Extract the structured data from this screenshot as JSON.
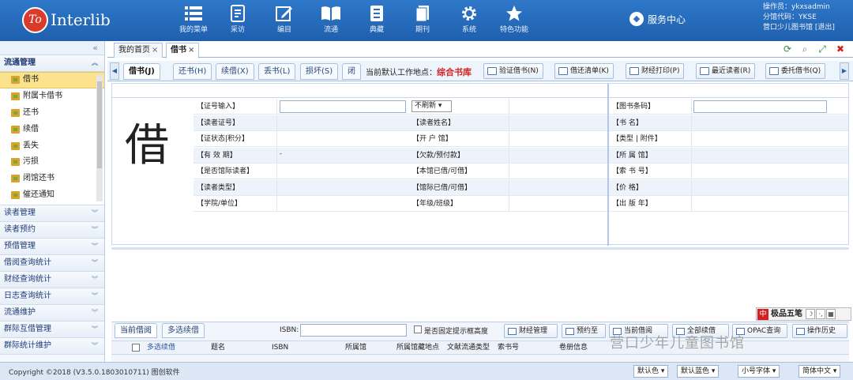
{
  "header": {
    "logo_text": "To",
    "brand": "Interlib",
    "nav": [
      {
        "label": "我的菜单",
        "icon": "menu-list-icon"
      },
      {
        "label": "采访",
        "icon": "document-icon"
      },
      {
        "label": "编目",
        "icon": "edit-icon"
      },
      {
        "label": "流通",
        "icon": "open-book-icon"
      },
      {
        "label": "典藏",
        "icon": "archive-icon"
      },
      {
        "label": "期刊",
        "icon": "periodical-icon"
      },
      {
        "label": "系统",
        "icon": "gear-icon"
      },
      {
        "label": "特色功能",
        "icon": "star-icon"
      }
    ],
    "service_center": "服务中心",
    "operator": "操作员：ykxsadmin",
    "branch_code": "分馆代码：YKSE",
    "library": "营口少儿图书馆",
    "logout": "[退出]"
  },
  "sidebar": {
    "collapse_icon": "«",
    "open_section": "流通管理",
    "items": [
      "借书",
      "附属卡借书",
      "还书",
      "续借",
      "丢失",
      "污损",
      "闭馆还书",
      "催还通知"
    ],
    "active_item": "借书",
    "sections": [
      "读者管理",
      "读者预约",
      "预借管理",
      "借阅查询统计",
      "财经查询统计",
      "日志查询统计",
      "流通维护",
      "群际互借管理",
      "群际统计维护"
    ]
  },
  "page_tabs": [
    {
      "label": "我的首页",
      "close": "×"
    },
    {
      "label": "借书",
      "close": "×"
    }
  ],
  "sub_tabs": [
    "借书(J)",
    "还书(H)",
    "续借(X)",
    "丢书(L)",
    "损坏(S)",
    "闭"
  ],
  "work_location": {
    "label": "当前默认工作地点：",
    "value": "综合书库"
  },
  "toolbar_buttons": [
    "验证借书(N)",
    "借还清单(K)",
    "财经打印(P)",
    "最近读者(R)",
    "委托借书(Q)"
  ],
  "form": {
    "big_char": "借",
    "left_labels": [
      "【证号输入】",
      "【读者证号】",
      "【证状态|积分】",
      "【有 效 期】",
      "【是否馆际读者】",
      "【读者类型】",
      "【学院/单位】"
    ],
    "mid_labels": [
      "【读者姓名】",
      "【开 户 馆】",
      "【欠款/预付款】",
      "【本馆已借/可借】",
      "【馆际已借/可借】",
      "【年级/班级】"
    ],
    "right_labels": [
      "【图书条码】",
      "【书 名】",
      "【类型 | 附件】",
      "【所 属 馆】",
      "【索 书 号】",
      "【价 格】",
      "【出 版 年】"
    ],
    "refresh_select": "不刷新 ▾",
    "validity_mark": "-"
  },
  "lower": {
    "tabs": [
      "当前借阅",
      "多选续借"
    ],
    "isbn_label": "ISBN:",
    "fixed_height_label": "是否固定提示框高度",
    "buttons": [
      "财经管理",
      "预约至",
      "当前借阅",
      "全部续借",
      "OPAC查询",
      "操作历史"
    ],
    "columns": [
      "多选续借",
      "题名",
      "ISBN",
      "所属馆",
      "所属馆藏地点",
      "文献流通类型",
      "索书号",
      "卷册信息"
    ]
  },
  "ime": {
    "zh": "中",
    "name": "极品五笔",
    "glyphs": [
      "☽",
      "·,",
      "▦"
    ]
  },
  "watermark": "营口少年儿童图书馆",
  "status": {
    "copyright": "Copyright ©2018 (V3.5.0.1803010711) 图创软件",
    "selects": [
      "默认色 ▾",
      "默认蓝色 ▾",
      "小号字体 ▾",
      "简体中文 ▾"
    ]
  },
  "colors": {
    "header": "#2f78c9",
    "accent_red": "#d62020",
    "active_item": "#fbe38e"
  }
}
